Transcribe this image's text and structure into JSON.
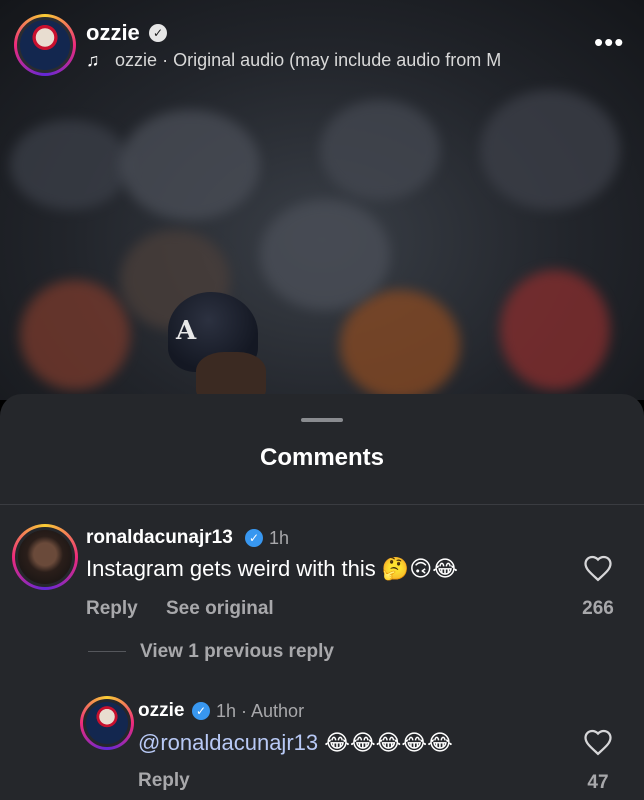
{
  "header": {
    "username": "ozzie",
    "audio_author": "ozzie",
    "audio_separator": "·",
    "audio_title": "Original audio",
    "audio_note": "(may include audio from M"
  },
  "comments_sheet": {
    "title": "Comments",
    "comments": [
      {
        "username": "ronaldacunajr13",
        "time": "1h",
        "text": "Instagram gets weird with this",
        "emojis": "🤔🙃😂",
        "reply_label": "Reply",
        "see_original_label": "See original",
        "like_count": "266",
        "view_replies_label": "View 1 previous reply"
      }
    ],
    "replies": [
      {
        "username": "ozzie",
        "meta": "1h · Author",
        "mention": "@ronaldacunajr13",
        "emojis": "😂😂😂😂😂",
        "reply_label": "Reply",
        "like_count": "47"
      }
    ]
  },
  "icons": [
    "verified-badge-icon",
    "music-note-icon",
    "more-options-icon",
    "heart-icon"
  ],
  "colors": {
    "sheet_bg": "#25272b",
    "muted_text": "#a8a8ab",
    "verified_blue": "#3897f0",
    "mention_blue": "#b8c9f5"
  }
}
